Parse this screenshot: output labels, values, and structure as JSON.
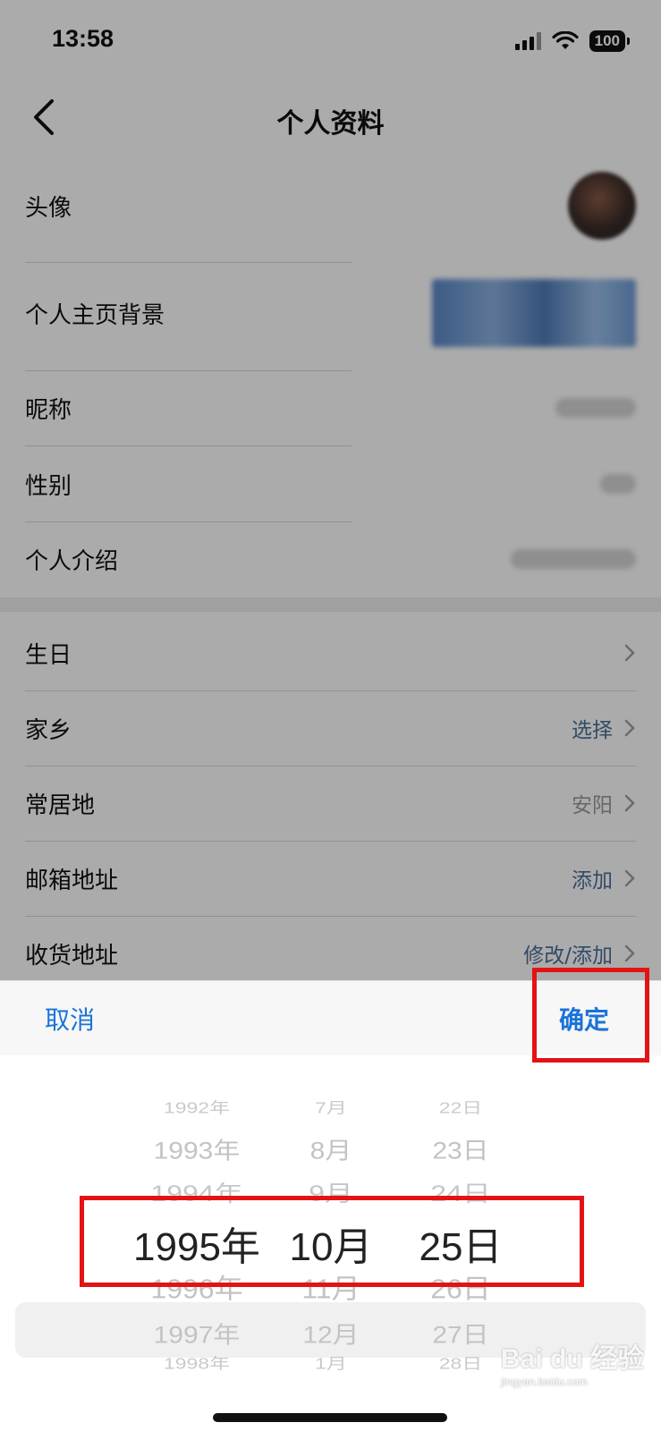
{
  "status_bar": {
    "time": "13:58",
    "battery": "100"
  },
  "navbar": {
    "title": "个人资料"
  },
  "profile": {
    "avatar_label": "头像",
    "background_label": "个人主页背景",
    "nickname_label": "昵称",
    "gender_label": "性别",
    "intro_label": "个人介绍"
  },
  "details": {
    "birthday_label": "生日",
    "hometown_label": "家乡",
    "hometown_value": "选择",
    "residence_label": "常居地",
    "residence_value": "安阳",
    "email_label": "邮箱地址",
    "email_value": "添加",
    "address_label": "收货地址",
    "address_value": "修改/添加"
  },
  "picker": {
    "cancel": "取消",
    "confirm": "确定",
    "years": [
      "1992年",
      "1993年",
      "1994年",
      "1995年",
      "1996年",
      "1997年",
      "1998年"
    ],
    "months": [
      "7月",
      "8月",
      "9月",
      "10月",
      "11月",
      "12月",
      "1月"
    ],
    "days": [
      "22日",
      "23日",
      "24日",
      "25日",
      "26日",
      "27日",
      "28日"
    ],
    "selected": {
      "year": "1995年",
      "month": "10月",
      "day": "25日"
    }
  },
  "watermark": {
    "brand": "Bai du 经验",
    "url": "jingyan.baidu.com"
  },
  "colors": {
    "accent": "#1a73d9",
    "highlight": "#e41313",
    "link": "#4c6f9a"
  }
}
